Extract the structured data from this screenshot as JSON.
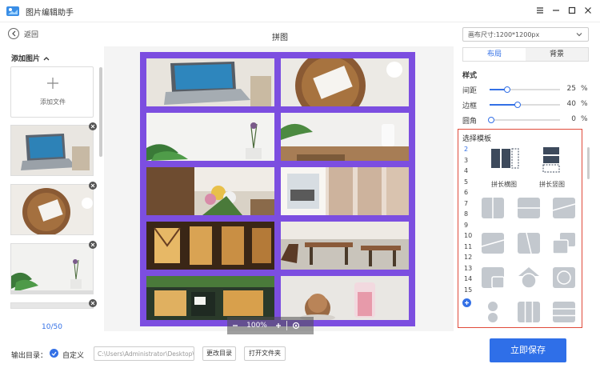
{
  "app": {
    "title": "图片编辑助手"
  },
  "nav": {
    "back_label": "返回",
    "page_title": "拼图"
  },
  "left_panel": {
    "add_images_heading": "添加图片",
    "add_file_label": "添加文件",
    "page_counter": "10/50",
    "thumbnails": [
      "laptop",
      "notebook",
      "plant",
      "table"
    ]
  },
  "canvas": {
    "border_color": "#7c4ee0",
    "zoom_value": "100%"
  },
  "right_panel": {
    "canvas_size": "画布尺寸:1200*1200px",
    "tabs": [
      {
        "label": "布局",
        "active": true
      },
      {
        "label": "背景",
        "active": false
      }
    ],
    "style_heading": "样式",
    "sliders": [
      {
        "label": "间距",
        "value": "25",
        "unit": "%",
        "level": 0.25
      },
      {
        "label": "边框",
        "value": "40",
        "unit": "%",
        "level": 0.4
      },
      {
        "label": "圆角",
        "value": "0",
        "unit": "%",
        "level": 0.0
      }
    ],
    "template_heading": "选择模板",
    "template_counts": [
      "2",
      "3",
      "4",
      "5",
      "6",
      "7",
      "8",
      "9",
      "10",
      "11",
      "12",
      "13",
      "14",
      "15"
    ],
    "active_count": "2",
    "templates": [
      {
        "label": "拼长横图",
        "icon": "horizontal-stitch-icon"
      },
      {
        "label": "拼长竖图",
        "icon": "vertical-stitch-icon"
      }
    ],
    "accent_color": "#3370e6",
    "highlight_color": "#e04a3a"
  },
  "bottom": {
    "output_label": "输出目录：",
    "custom_label": "自定义",
    "output_path": "C:\\Users\\Administrator\\Desktop\\图",
    "change_dir_label": "更改目录",
    "open_folder_label": "打开文件夹",
    "save_label": "立即保存"
  }
}
